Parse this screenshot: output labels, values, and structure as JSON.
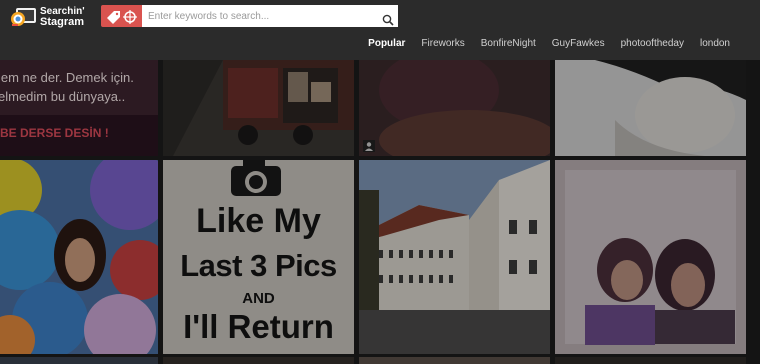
{
  "header": {
    "logo_line1": "Searchin'",
    "logo_line2": "Stagram",
    "search_placeholder": "Enter keywords to search..."
  },
  "nav": {
    "items": [
      {
        "label": "Popular",
        "active": true
      },
      {
        "label": "Fireworks",
        "active": false
      },
      {
        "label": "BonfireNight",
        "active": false
      },
      {
        "label": "GuyFawkes",
        "active": false
      },
      {
        "label": "photooftheday",
        "active": false
      },
      {
        "label": "london",
        "active": false
      }
    ]
  },
  "tiles": {
    "t1_line1": "lem ne der. Demek için.",
    "t1_line2": "elmedim bu dünyaya..",
    "t1_line3": "BE DERSE DESİN !",
    "like_line1": "Like My",
    "like_line2": "Last 3 Pics",
    "like_line3": "AND",
    "like_line4": "I'll Return"
  },
  "colors": {
    "topbar": "#2b2b2b",
    "search_tag": "#d9534f",
    "nav_active": "#ffffff",
    "nav_text": "#d0d0d0"
  }
}
